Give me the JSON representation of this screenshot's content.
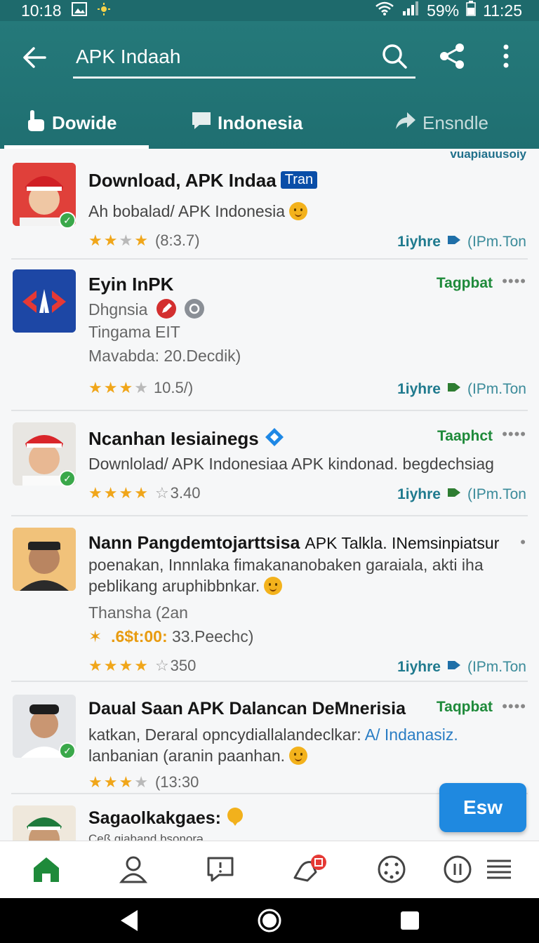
{
  "status_bar": {
    "left_time": "10:18",
    "battery": "59%",
    "right_time": "11:25"
  },
  "search": {
    "value": "APK Indaah"
  },
  "tabs": [
    {
      "label": "Dowide",
      "icon": "hand-pointer-icon",
      "active": true
    },
    {
      "label": "Indonesia",
      "icon": "chat-bubble-icon",
      "active": false
    },
    {
      "label": "Ensndle",
      "icon": "share-arrow-icon",
      "active": false
    }
  ],
  "list_header_fragment": "vuapiauusoiy",
  "items": [
    {
      "title": "Download, APK Indaa",
      "badge": "Tran",
      "line1": "Ah bobalad/ APK Indonesia",
      "rating": "(8:3.7)",
      "meta_a": "1iyhre",
      "meta_b": "(IPm.Ton"
    },
    {
      "title": "Eyin InPK",
      "tag": "Tagpbat",
      "line1": "Dhgnsia",
      "line2": "Tingama EIT",
      "line3": "Mavabda: 20.Decdik)",
      "rating": "10.5/)",
      "meta_a": "1iyhre",
      "meta_b": "(IPm.Ton"
    },
    {
      "title": "Ncanhan Iesiainegs",
      "tag": "Taaphct",
      "line1": "Downlolad/ APK Indonesiaa APK kindonad. begdechsiag",
      "rating": "3.40",
      "meta_a": "1iyhre",
      "meta_b": "(IPm.Ton"
    },
    {
      "title": "Nann Pangdemtojarttsisa",
      "title_tail": "APK Talkla. INemsinpiatsur",
      "line1": "poenakan, Innnlaka fimakananobaken garaiala, akti iha",
      "line2": "peblikang aruphibbnkar.",
      "line3": "Thansha (2an",
      "line4_prefix": "✶ .6$t:00:",
      "line4": "33.Peechc)",
      "rating": "350",
      "meta_a": "1iyhre",
      "meta_b": "(IPm.Ton"
    },
    {
      "title": "Daual Saan APK Dalancan DeMnerisia",
      "tag": "Taqpbat",
      "line1": "katkan, Deraral opncydiallalandeclkar:",
      "line1_link": "A/ Indanasiz.",
      "line2": "lanbanian (aranin paanhan.",
      "rating": "(13:30"
    },
    {
      "title": "Sagaolkakgaes:",
      "line1": "Ceß gjaband bsonorə"
    }
  ],
  "fab_label": "Esw"
}
